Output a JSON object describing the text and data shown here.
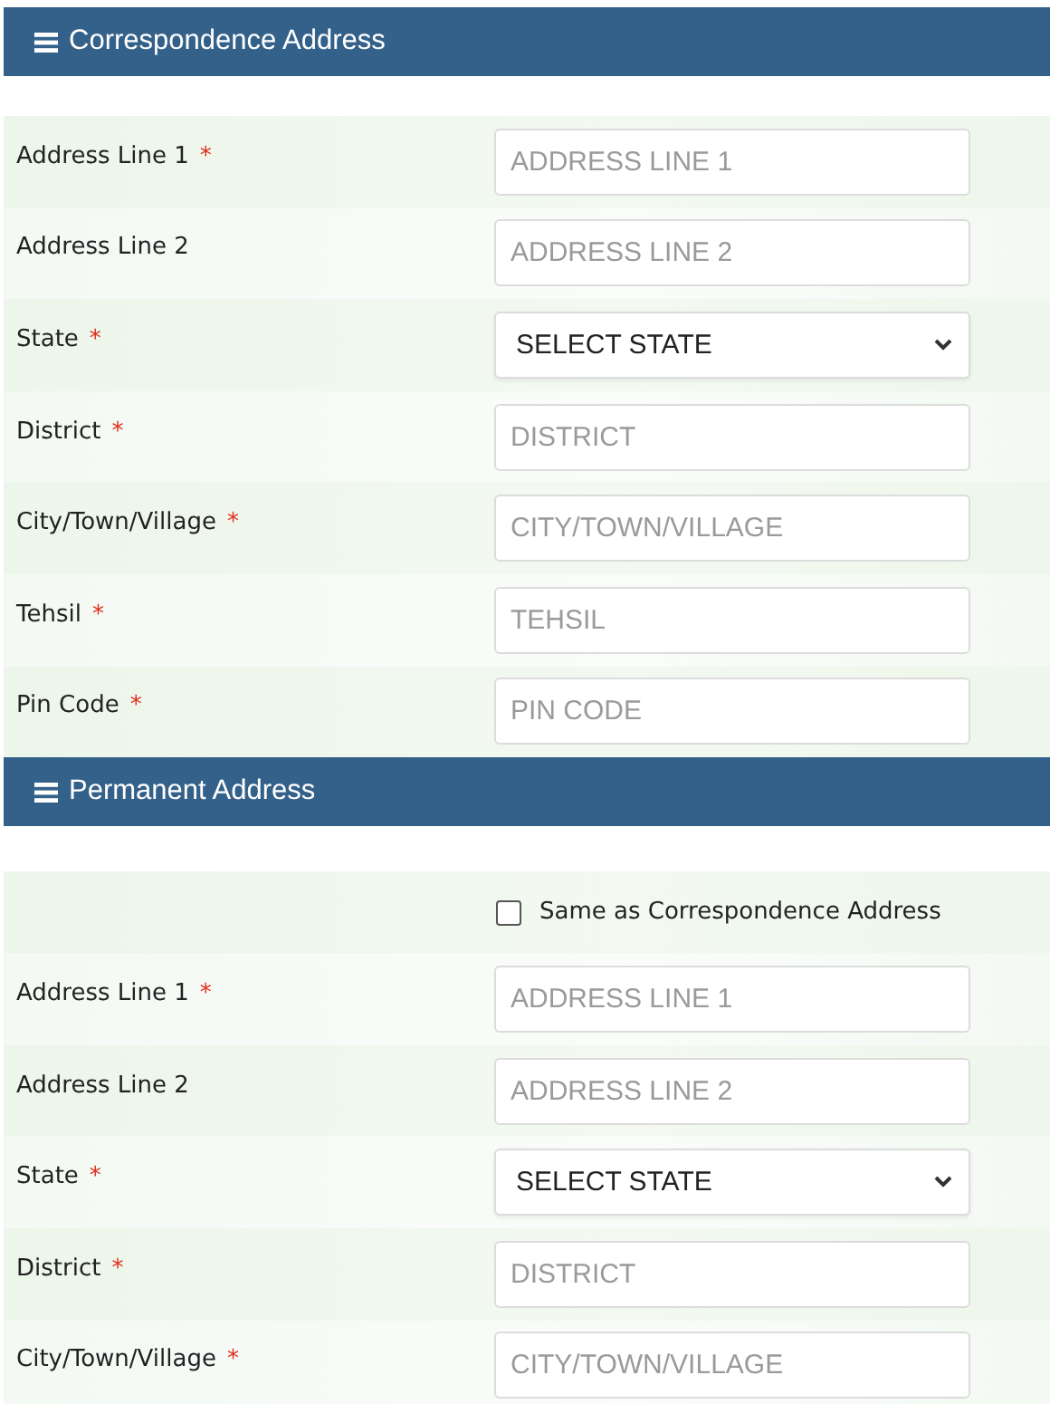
{
  "sections": [
    {
      "title": "Correspondence Address",
      "rows": [
        {
          "kind": "input",
          "label": "Address Line 1",
          "mark": "*",
          "placeholder": "ADDRESS LINE 1"
        },
        {
          "kind": "input",
          "label": "Address Line 2",
          "placeholder": "ADDRESS LINE 2"
        },
        {
          "kind": "select",
          "label": "State",
          "mark": "*",
          "value": "SELECT STATE"
        },
        {
          "kind": "input",
          "label": "District",
          "mark": "*",
          "placeholder": "DISTRICT"
        },
        {
          "kind": "input",
          "label": "City/Town/Village",
          "mark": "*",
          "placeholder": "CITY/TOWN/VILLAGE"
        },
        {
          "kind": "input",
          "label": "Tehsil",
          "mark": "*",
          "placeholder": "TEHSIL"
        },
        {
          "kind": "input",
          "label": "Pin Code",
          "mark": "*",
          "placeholder": "PIN CODE"
        }
      ]
    },
    {
      "title": "Permanent Address",
      "rows": [
        {
          "kind": "checkbox",
          "label": "Same as Correspondence Address",
          "checked": false
        },
        {
          "kind": "input",
          "label": "Address Line 1",
          "mark": "*",
          "placeholder": "ADDRESS LINE 1"
        },
        {
          "kind": "input",
          "label": "Address Line 2",
          "placeholder": "ADDRESS LINE 2"
        },
        {
          "kind": "select",
          "label": "State",
          "mark": "*",
          "value": "SELECT STATE"
        },
        {
          "kind": "input",
          "label": "District",
          "mark": "*",
          "placeholder": "DISTRICT"
        },
        {
          "kind": "input",
          "label": "City/Town/Village",
          "mark": "*",
          "placeholder": "CITY/TOWN/VILLAGE"
        }
      ]
    }
  ]
}
